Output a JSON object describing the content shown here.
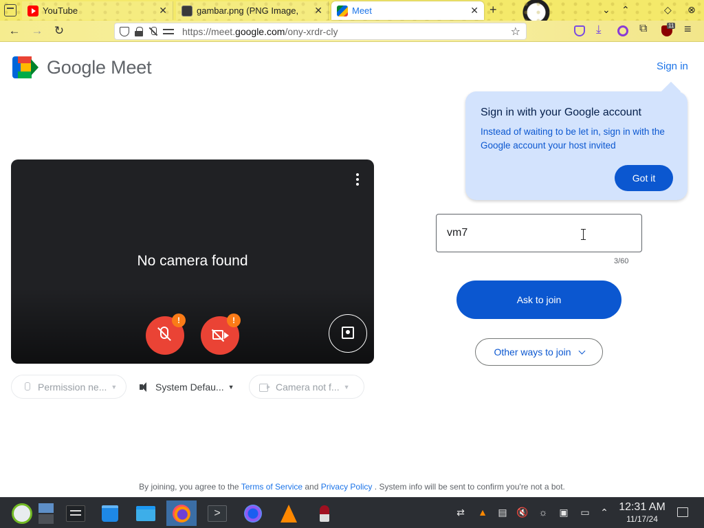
{
  "browser": {
    "tabs": [
      {
        "title": "YouTube",
        "favicon": "youtube-icon",
        "active": false
      },
      {
        "title": "gambar.png (PNG Image,",
        "favicon": "image-icon",
        "active": false
      },
      {
        "title": "Meet",
        "favicon": "meet-icon",
        "active": true
      }
    ],
    "url_prefix": "https://meet.",
    "url_domain": "google.com",
    "url_path": "/ony-xrdr-cly",
    "extension_badge": "11"
  },
  "meet": {
    "logo_text": "Google Meet",
    "sign_in": "Sign in",
    "preview": {
      "no_camera": "No camera found",
      "warning_badge": "!"
    },
    "devices": {
      "mic": "Permission ne...",
      "speaker": "System Defau...",
      "camera": "Camera not f..."
    },
    "callout": {
      "title": "Sign in with your Google account",
      "body": "Instead of waiting to be let in, sign in with the Google account your host invited",
      "button": "Got it"
    },
    "name_input": {
      "value": "vm7",
      "counter": "3/60"
    },
    "ask_button": "Ask to join",
    "other_ways": "Other ways to join",
    "footer": {
      "prefix": "By joining, you agree to the ",
      "tos": "Terms of Service",
      "and": " and ",
      "privacy": "Privacy Policy",
      "suffix": " . System info will be sent to confirm you're not a bot."
    }
  },
  "taskbar": {
    "time": "12:31 AM",
    "date": "11/17/24"
  },
  "colors": {
    "primary_blue": "#0b57d0",
    "link_blue": "#1a73e8",
    "danger_red": "#ea4335",
    "callout_bg": "#d3e3fd",
    "warning_orange": "#fa7b17"
  }
}
